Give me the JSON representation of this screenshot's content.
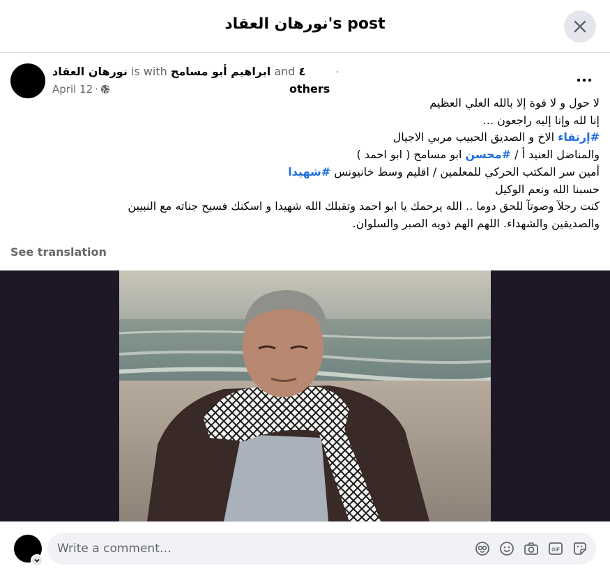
{
  "dialog": {
    "title": "نورهان العقاد's post"
  },
  "post": {
    "author": "نورهان العقاد",
    "with_text": "is with",
    "tagged": "ابراهيم أبو مسامح",
    "and_text": "and",
    "others_count": "٤",
    "others_label": "others",
    "dot": ".",
    "date": "April 12",
    "date_sep": "·",
    "privacy_icon": "globe-icon",
    "more_icon": "more-options-icon",
    "lines": {
      "l1": "لا حول و لا قوة إلا بالله العلي العظيم",
      "l2": "إنا لله وإنا إليه راجعون ...",
      "l3_tag": "#إرتقاء",
      "l3_rest": " الاخ و الصديق الحبيب مربي الاجيال",
      "l4_pre": "والمناضل العنيد أ / ",
      "l4_tag": "#محسن",
      "l4_rest": " ابو مسامح ( ابو احمد )",
      "l5_pre": "أمين سر المكتب الحركي للمعلمين / اقليم وسط خانيونس ",
      "l5_tag": "#شهيدا",
      "l6": "حسبنا الله ونعم الوكيل",
      "l7": "كنت رجلآ وصوتآ للحق دوما .. الله يرحمك يا ابو احمد وتقبلك الله شهيدا و اسكنك فسيح جناته مع النبيين",
      "l8": "والصديقين والشهداء. اللهم الهم ذويه الصبر والسلوان."
    },
    "see_translation": "See translation"
  },
  "comment": {
    "placeholder": "Write a comment…",
    "icons": [
      "avatar-sticker-icon",
      "emoji-icon",
      "camera-icon",
      "gif-icon",
      "sticker-icon"
    ]
  },
  "colors": {
    "hashtag": "#216fdb",
    "muted": "#65676b",
    "media_bg": "#1e1826"
  }
}
